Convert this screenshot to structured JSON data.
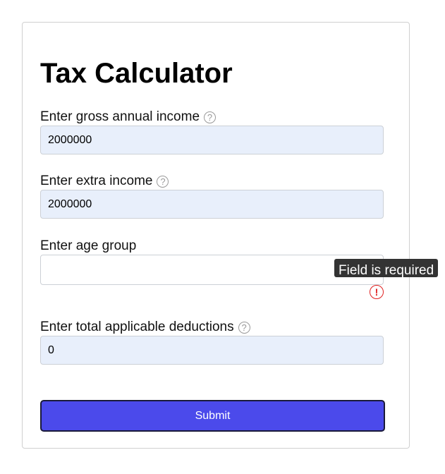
{
  "title": "Tax Calculator",
  "fields": [
    {
      "label": "Enter gross annual income",
      "value": "2000000",
      "help": "?"
    },
    {
      "label": "Enter extra income",
      "value": "2000000",
      "help": "?"
    },
    {
      "label": "Enter age group",
      "value": ""
    },
    {
      "label": "Enter total applicable deductions",
      "value": "0",
      "help": "?"
    }
  ],
  "error": {
    "icon": "!",
    "tooltip": "Field is required"
  },
  "submit_label": "Submit"
}
